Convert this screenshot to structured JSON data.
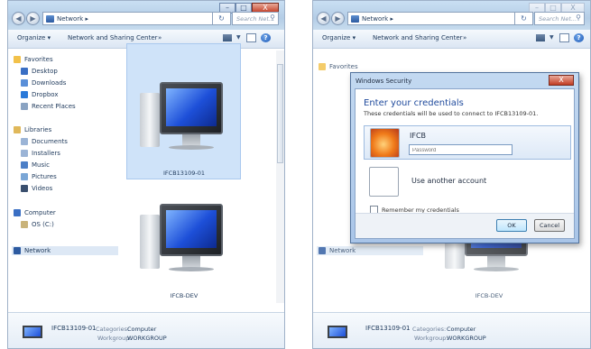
{
  "left_window": {
    "window_buttons": [
      "–",
      "□",
      "X"
    ],
    "address": "Network ▸",
    "search_placeholder": "Search Net...",
    "toolbar": {
      "organize": "Organize ▾",
      "network_center": "Network and Sharing Center",
      "more": "»"
    },
    "nav": {
      "favorites": "Favorites",
      "desktop": "Desktop",
      "downloads": "Downloads",
      "dropbox": "Dropbox",
      "recent": "Recent Places",
      "libraries": "Libraries",
      "documents": "Documents",
      "installers": "Installers",
      "music": "Music",
      "pictures": "Pictures",
      "videos": "Videos",
      "computer": "Computer",
      "os": "OS (C:)",
      "network": "Network"
    },
    "computers": [
      "IFCB13109-01",
      "IFCB-DEV"
    ],
    "details": {
      "name": "IFCB13109-01",
      "categories_key": "Categories:",
      "categories_val": "Computer",
      "workgroup_key": "Workgroup:",
      "workgroup_val": "WORKGROUP"
    }
  },
  "right_window": {
    "window_buttons": [
      "–",
      "□",
      "X"
    ],
    "address": "Network ▸",
    "search_placeholder": "Search Net...",
    "toolbar": {
      "organize": "Organize ▾",
      "network_center": "Network and Sharing Center",
      "more": "»"
    },
    "nav": {
      "favorites": "Favorites",
      "network": "Network"
    },
    "computers": [
      "IFCB-DEV"
    ],
    "details": {
      "name": "IFCB13109-01",
      "categories_key": "Categories:",
      "categories_val": "Computer",
      "workgroup_key": "Workgroup:",
      "workgroup_val": "WORKGROUP"
    }
  },
  "dialog": {
    "title": "Windows Security",
    "close": "X",
    "heading": "Enter your credentials",
    "subtitle": "These credentials will be used to connect to IFCB13109-01.",
    "user_name": "IFCB",
    "password_placeholder": "Password",
    "another_account": "Use another account",
    "remember": "Remember my credentials",
    "ok": "OK",
    "cancel": "Cancel"
  }
}
